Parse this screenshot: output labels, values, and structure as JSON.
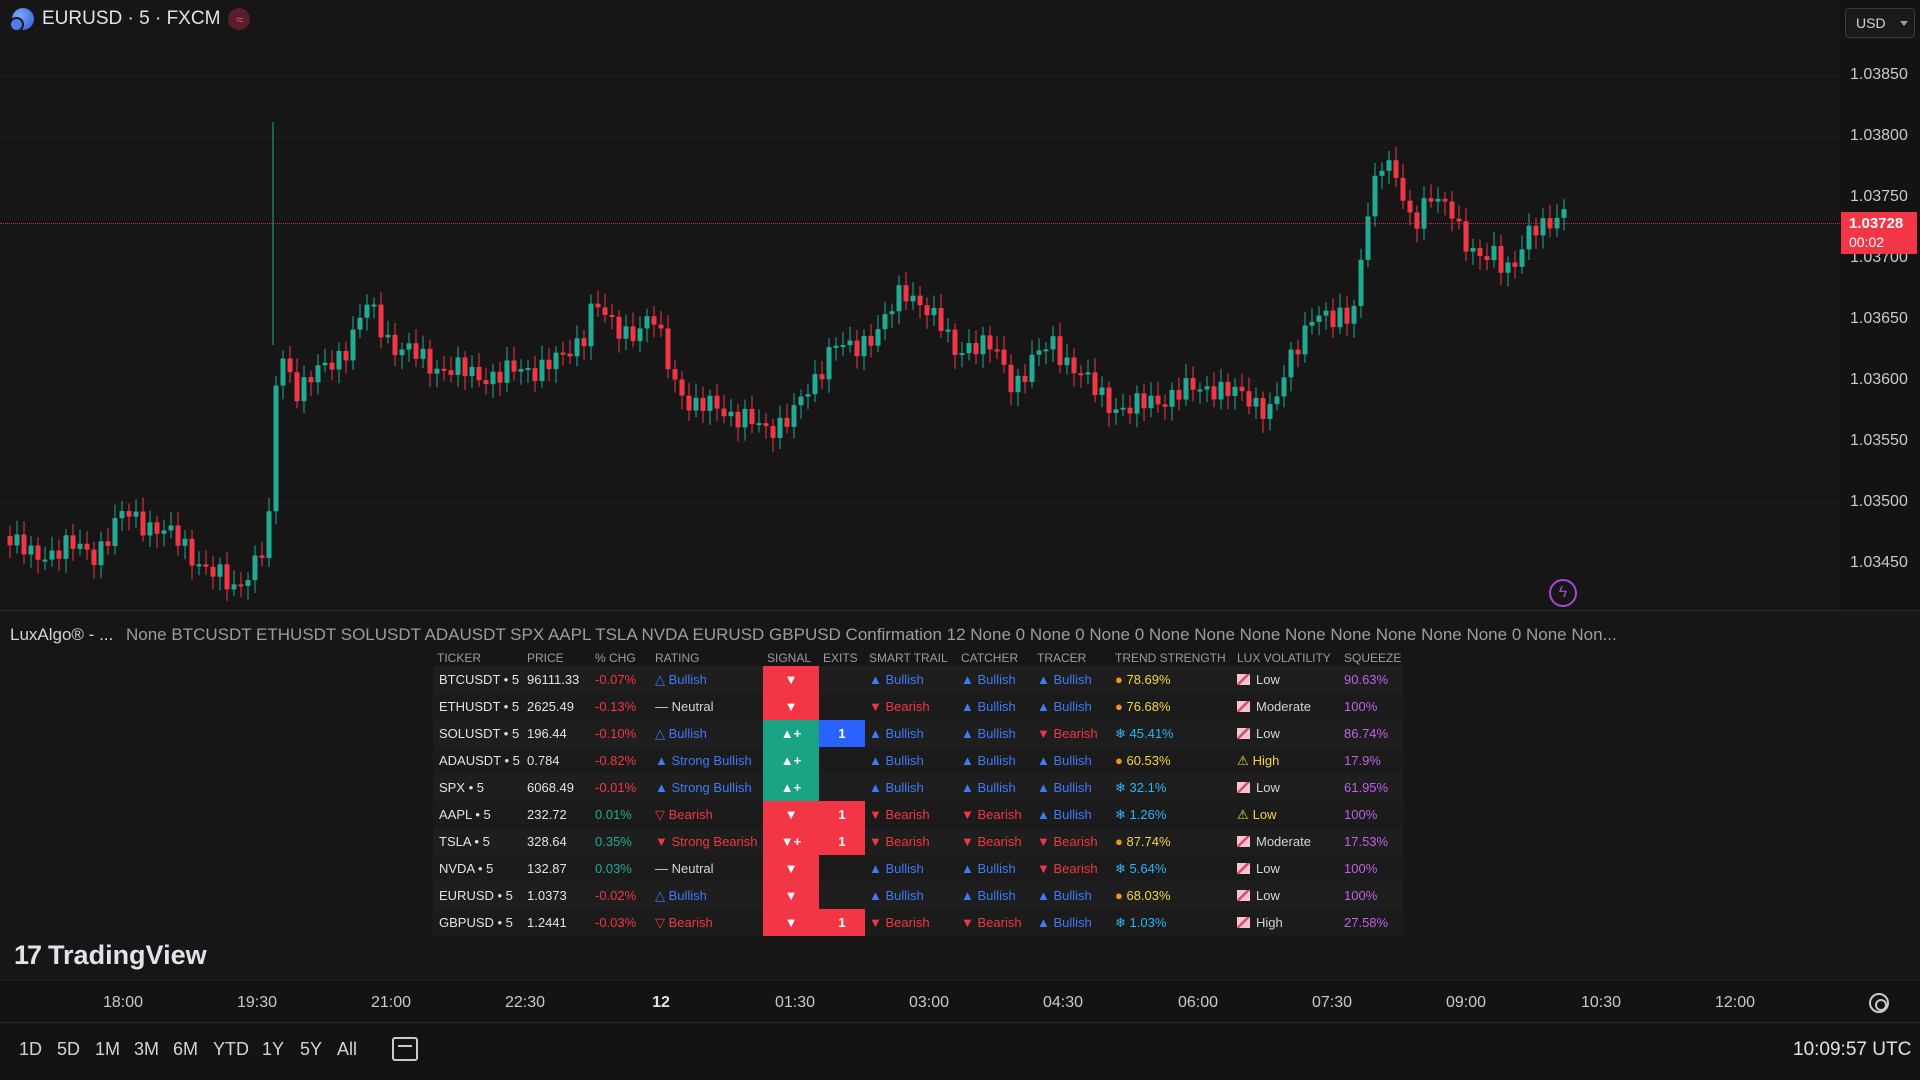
{
  "symbol": {
    "title": "EURUSD · 5 · FXCM",
    "currency": "USD"
  },
  "price_scale": {
    "labels": [
      "1.03850",
      "1.03800",
      "1.03750",
      "1.03700",
      "1.03650",
      "1.03600",
      "1.03550",
      "1.03500",
      "1.03450"
    ],
    "last_price": "1.03728",
    "countdown": "00:02"
  },
  "colors": {
    "up": "#22ab94",
    "down": "#f23645",
    "background": "#161616"
  },
  "indicator": {
    "name": "LuxAlgo® - ...",
    "params": "None BTCUSDT ETHUSDT SOLUSDT ADAUSDT SPX AAPL TSLA NVDA EURUSD GBPUSD Confirmation 12 None 0 None 0 None 0 None None None None None None None None 0 None Non..."
  },
  "screener": {
    "headers": [
      "TICKER",
      "PRICE",
      "% CHG",
      "RATING",
      "SIGNAL",
      "EXITS",
      "SMART TRAIL",
      "CATCHER",
      "TRACER",
      "TREND STRENGTH",
      "LUX VOLATILITY",
      "SQUEEZE"
    ],
    "rows": [
      {
        "ticker": "BTCUSDT • 5",
        "price": "96111.33",
        "chg": "-0.07%",
        "rating": "△ Bullish",
        "signal": "▼",
        "exit": "",
        "trail": "▲ Bullish",
        "catcher": "▲ Bullish",
        "tracer": "▲ Bullish",
        "strength": "78.69%",
        "volatility": "Low",
        "squeeze": "90.63%"
      },
      {
        "ticker": "ETHUSDT • 5",
        "price": "2625.49",
        "chg": "-0.13%",
        "rating": "— Neutral",
        "signal": "▼",
        "exit": "",
        "trail": "▼ Bearish",
        "catcher": "▲ Bullish",
        "tracer": "▲ Bullish",
        "strength": "76.68%",
        "volatility": "Moderate",
        "squeeze": "100%"
      },
      {
        "ticker": "SOLUSDT • 5",
        "price": "196.44",
        "chg": "-0.10%",
        "rating": "△ Bullish",
        "signal": "▲+",
        "exit": "1",
        "trail": "▲ Bullish",
        "catcher": "▲ Bullish",
        "tracer": "▼ Bearish",
        "strength": "45.41%",
        "volatility": "Low",
        "squeeze": "86.74%"
      },
      {
        "ticker": "ADAUSDT • 5",
        "price": "0.784",
        "chg": "-0.82%",
        "rating": "▲ Strong Bullish",
        "signal": "▲+",
        "exit": "",
        "trail": "▲ Bullish",
        "catcher": "▲ Bullish",
        "tracer": "▲ Bullish",
        "strength": "60.53%",
        "volatility": "High",
        "squeeze": "17.9%"
      },
      {
        "ticker": "SPX • 5",
        "price": "6068.49",
        "chg": "-0.01%",
        "rating": "▲ Strong Bullish",
        "signal": "▲+",
        "exit": "",
        "trail": "▲ Bullish",
        "catcher": "▲ Bullish",
        "tracer": "▲ Bullish",
        "strength": "32.1%",
        "volatility": "Low",
        "squeeze": "61.95%"
      },
      {
        "ticker": "AAPL • 5",
        "price": "232.72",
        "chg": "0.01%",
        "rating": "▽ Bearish",
        "signal": "▼",
        "exit": "1",
        "trail": "▼ Bearish",
        "catcher": "▼ Bearish",
        "tracer": "▲ Bullish",
        "strength": "1.26%",
        "volatility": "Low",
        "squeeze": "100%"
      },
      {
        "ticker": "TSLA • 5",
        "price": "328.64",
        "chg": "0.35%",
        "rating": "▼ Strong Bearish",
        "signal": "▼+",
        "exit": "1",
        "trail": "▼ Bearish",
        "catcher": "▼ Bearish",
        "tracer": "▼ Bearish",
        "strength": "87.74%",
        "volatility": "Moderate",
        "squeeze": "17.53%"
      },
      {
        "ticker": "NVDA • 5",
        "price": "132.87",
        "chg": "0.03%",
        "rating": "— Neutral",
        "signal": "▼",
        "exit": "",
        "trail": "▲ Bullish",
        "catcher": "▲ Bullish",
        "tracer": "▼ Bearish",
        "strength": "5.64%",
        "volatility": "Low",
        "squeeze": "100%"
      },
      {
        "ticker": "EURUSD • 5",
        "price": "1.0373",
        "chg": "-0.02%",
        "rating": "△ Bullish",
        "signal": "▼",
        "exit": "",
        "trail": "▲ Bullish",
        "catcher": "▲ Bullish",
        "tracer": "▲ Bullish",
        "strength": "68.03%",
        "volatility": "Low",
        "squeeze": "100%"
      },
      {
        "ticker": "GBPUSD • 5",
        "price": "1.2441",
        "chg": "-0.03%",
        "rating": "▽ Bearish",
        "signal": "▼",
        "exit": "1",
        "trail": "▼ Bearish",
        "catcher": "▼ Bearish",
        "tracer": "▲ Bullish",
        "strength": "1.03%",
        "volatility": "High",
        "squeeze": "27.58%"
      }
    ]
  },
  "time_axis": [
    "18:00",
    "19:30",
    "21:00",
    "22:30",
    "12",
    "01:30",
    "03:00",
    "04:30",
    "06:00",
    "07:30",
    "09:00",
    "10:30",
    "12:00"
  ],
  "branding": "TradingView",
  "toolbar": {
    "ranges": [
      "1D",
      "5D",
      "1M",
      "3M",
      "6M",
      "YTD",
      "1Y",
      "5Y",
      "All"
    ],
    "clock": "10:09:57 UTC"
  }
}
